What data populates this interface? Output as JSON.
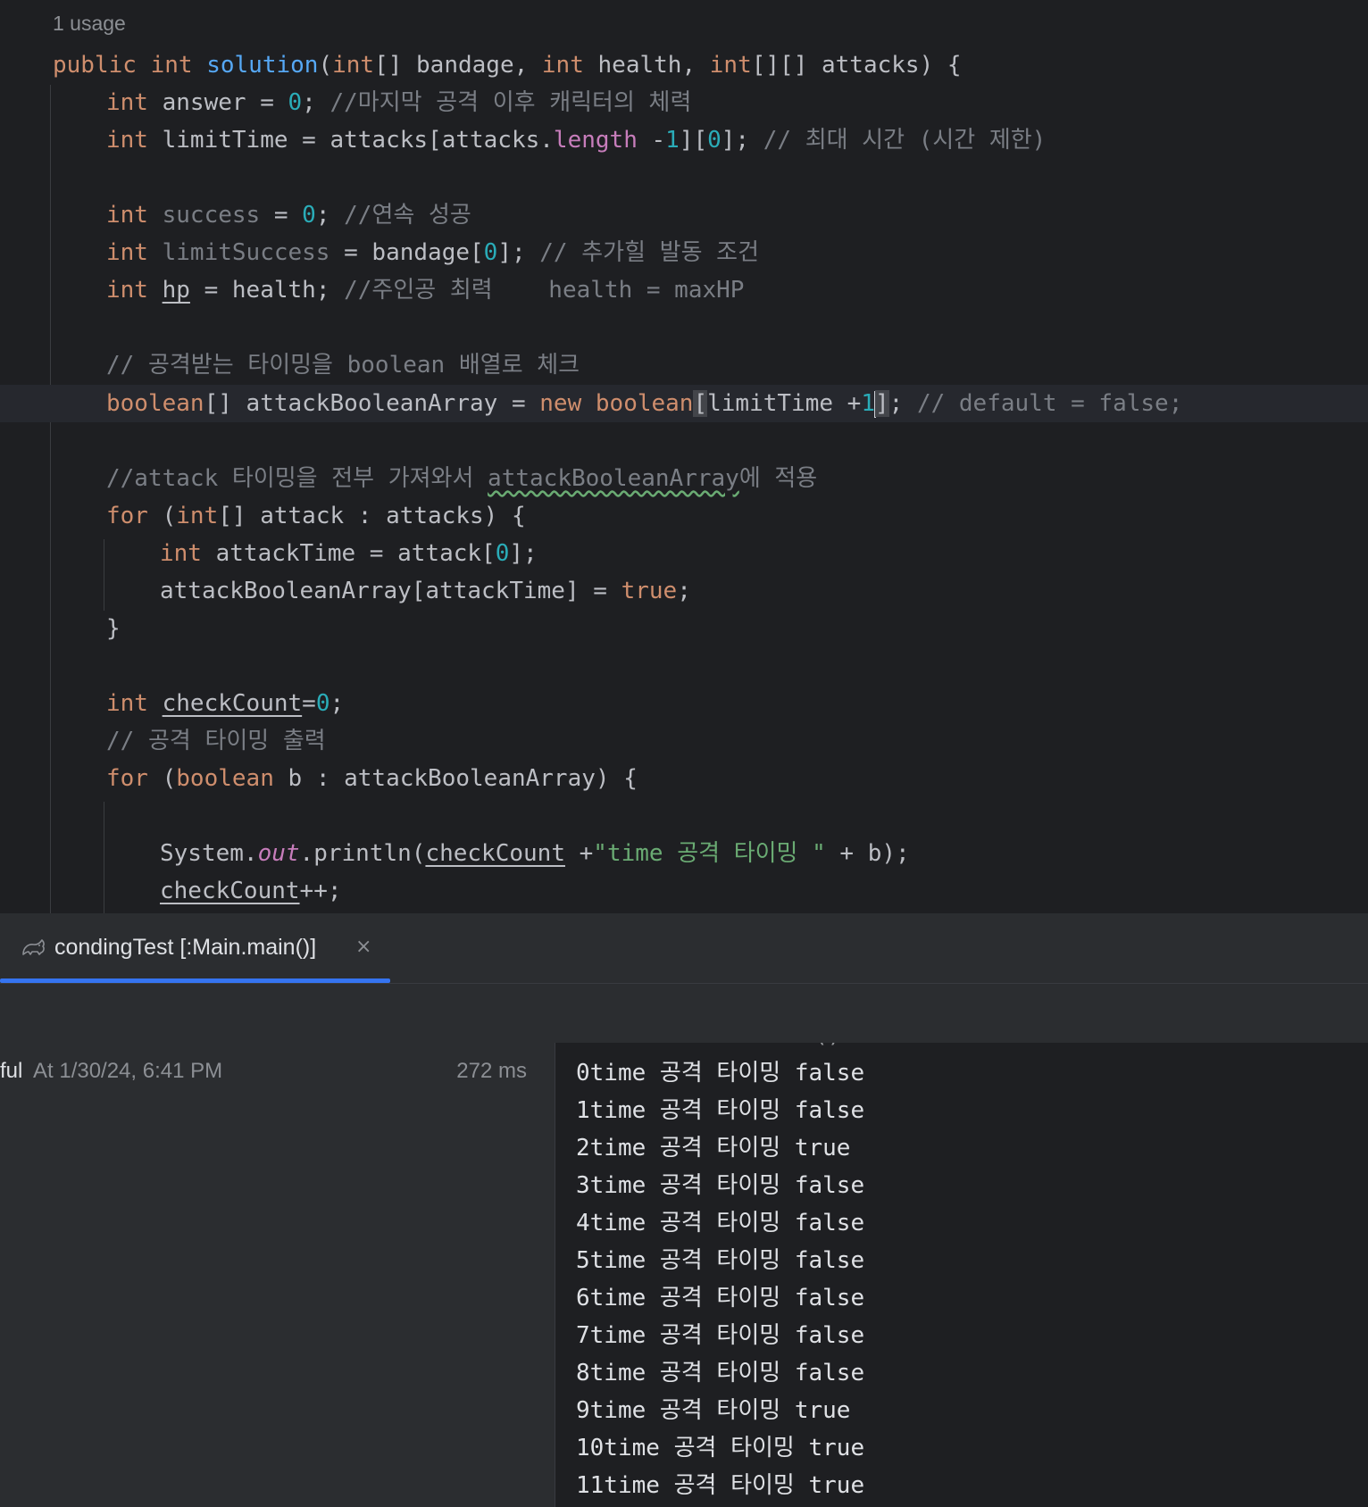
{
  "editor": {
    "usage_hint": "1 usage",
    "lines": {
      "sig_public": "public",
      "sig_int": "int",
      "sig_name": "solution",
      "sig_params": "(int[] bandage, int health, int[][] attacks) {",
      "answer_cmt": "//마지막 공격 이후 캐릭터의 체력",
      "limitTime_cmt": "// 최대 시간 (시간 제한)",
      "success_cmt": "//연속 성공",
      "limitSuccess_cmt": "// 추가힐 발동 조건",
      "hp_cmt": "//주인공 최력    health = maxHP",
      "check_cmt": "// 공격받는 타이밍을 boolean 배열로 체크",
      "default_cmt": "// default = false;",
      "apply_cmt_a": "//attack 타이밍을 전부 가져와서 ",
      "apply_cmt_b": "attackBooleanArray",
      "apply_cmt_c": "에 적용",
      "print_cmt": "// 공격 타이밍 출력",
      "print_str": "\"time 공격 타이밍 \""
    }
  },
  "run_panel": {
    "tab_label": "condingTest [:Main.main()]",
    "tab_close": "×",
    "tree_status": "ful",
    "tree_time": "At 1/30/24, 6:41 PM",
    "tree_duration": "272 ms",
    "console_cut": "> Task :Main.main()",
    "console_lines": [
      "0time 공격 타이밍 false",
      "1time 공격 타이밍 false",
      "2time 공격 타이밍 true",
      "3time 공격 타이밍 false",
      "4time 공격 타이밍 false",
      "5time 공격 타이밍 false",
      "6time 공격 타이밍 false",
      "7time 공격 타이밍 false",
      "8time 공격 타이밍 false",
      "9time 공격 타이밍 true",
      "10time 공격 타이밍 true",
      "11time 공격 타이밍 true"
    ]
  },
  "colors": {
    "accent": "#3574f0",
    "keyword": "#cf8e6d",
    "function": "#56a8f5",
    "number": "#2aacb8",
    "string": "#6aab73",
    "comment": "#7a7e85"
  }
}
